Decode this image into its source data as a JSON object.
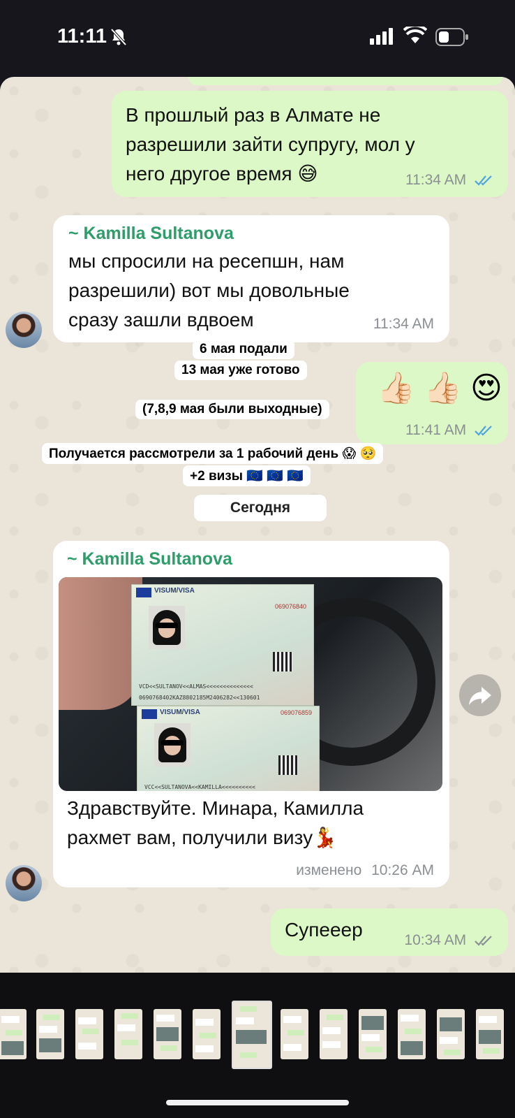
{
  "status_bar": {
    "time": "11:11",
    "icons": [
      "bell-slash-icon",
      "signal-icon",
      "wifi-icon",
      "battery-icon"
    ]
  },
  "messages": [
    {
      "type": "outgoing",
      "text_lines": [
        "В прошлый раз в Алмате не",
        "разрешили зайти супругу, мол у",
        "него другое время 😅"
      ],
      "time": "11:34 AM",
      "status": "read"
    },
    {
      "type": "incoming",
      "sender": "~ Kamilla Sultanova",
      "text_lines": [
        "мы спросили на ресепшн, нам",
        "разрешили) вот мы довольные",
        "сразу зашли вдвоем"
      ],
      "time": "11:34 AM"
    },
    {
      "type": "outgoing",
      "emoji": "👍🏻 👍🏻 😍",
      "time": "11:41 AM",
      "status": "read"
    },
    {
      "type": "incoming",
      "sender": "~ Kamilla Sultanova",
      "image": "visa-photo",
      "text_lines": [
        "Здравствуйте. Минара, Камилла",
        "рахмет вам, получили визу💃"
      ],
      "edited_label": "изменено",
      "time": "10:26 AM"
    },
    {
      "type": "outgoing",
      "text_lines": [
        "Супееер"
      ],
      "time": "10:34 AM",
      "status": "delivered"
    }
  ],
  "captions": [
    "6 мая подали",
    "13 мая уже готово",
    "(7,8,9 мая были выходные)",
    "Получается рассмотрели за 1 рабочий день 😱 🥺",
    "+2 визы 🇪🇺 🇪🇺 🇪🇺"
  ],
  "date_separator": "Сегодня",
  "visa_card": {
    "header": "VISUM/VISA",
    "number_top": "069076840",
    "number_bottom": "069076859",
    "mrz_top_1": "VCD<<SULTANOV<<ALMAS<<<<<<<<<<<<<<",
    "mrz_top_2": "0690768402KAZ8802185M2406282<<130601",
    "mrz_bottom": "VCC<<SULTANOVA<<KAMILLA<<<<<<<<<<"
  },
  "colors": {
    "outgoing_bubble": "#dcf8c6",
    "incoming_bubble": "#ffffff",
    "sender_name": "#2e9d69",
    "read_tick": "#4fa3e0",
    "chat_background": "#ebe4d8"
  },
  "thumbnail_strip": {
    "count": 13,
    "active_index": 6
  }
}
